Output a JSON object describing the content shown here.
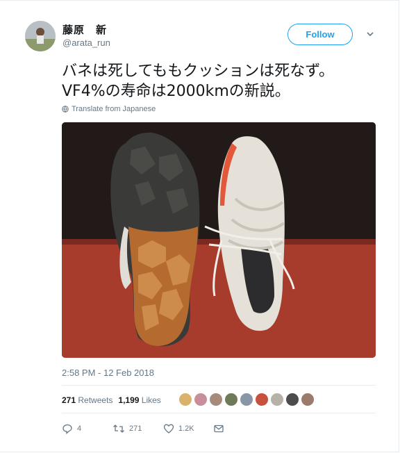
{
  "user": {
    "display_name": "藤原　新",
    "handle": "@arata_run"
  },
  "follow_label": "Follow",
  "tweet": {
    "text_line1": "バネは死してももクッションは死なず。",
    "text_line2": "VF4%の寿命は2000kmの新説。",
    "translate_label": "Translate from Japanese",
    "timestamp": "2:58 PM - 12 Feb 2018"
  },
  "stats": {
    "retweets_count": "271",
    "retweets_label": "Retweets",
    "likes_count": "1,199",
    "likes_label": "Likes"
  },
  "actions": {
    "reply_count": "4",
    "retweet_count": "271",
    "like_count": "1.2K"
  },
  "colors": {
    "accent": "#1da1f2",
    "muted": "#657786"
  }
}
